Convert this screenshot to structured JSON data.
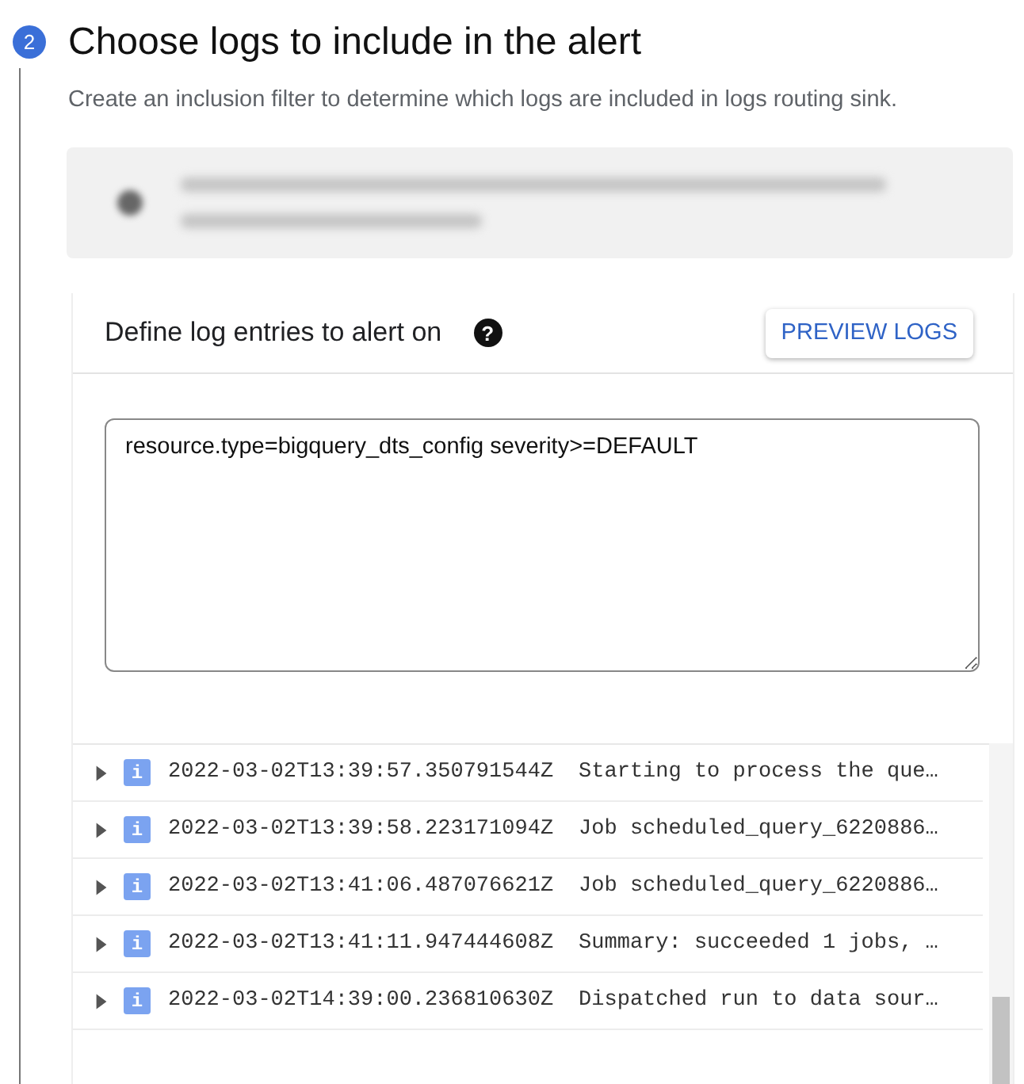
{
  "step": {
    "number": "2",
    "title": "Choose logs to include in the alert",
    "description": "Create an inclusion filter to determine which logs are included in logs routing sink."
  },
  "query_card": {
    "title": "Define log entries to alert on",
    "help_icon": "?",
    "button": "PREVIEW LOGS",
    "query": "resource.type=bigquery_dts_config severity>=DEFAULT"
  },
  "log_entries": [
    {
      "expanded": false,
      "severity": "i",
      "timestamp": "2022-03-02T13:39:57.350791544Z",
      "message": "Starting to process the que…"
    },
    {
      "expanded": false,
      "severity": "i",
      "timestamp": "2022-03-02T13:39:58.223171094Z",
      "message": "Job scheduled_query_6220886…"
    },
    {
      "expanded": false,
      "severity": "i",
      "timestamp": "2022-03-02T13:41:06.487076621Z",
      "message": "Job scheduled_query_6220886…"
    },
    {
      "expanded": false,
      "severity": "i",
      "timestamp": "2022-03-02T13:41:11.947444608Z",
      "message": "Summary: succeeded 1 jobs, …"
    },
    {
      "expanded": false,
      "severity": "i",
      "timestamp": "2022-03-02T14:39:00.236810630Z",
      "message": "Dispatched run to data sour…"
    }
  ]
}
